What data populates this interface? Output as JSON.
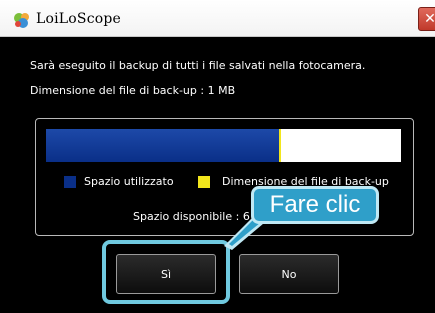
{
  "window": {
    "title": "LoiLoScope",
    "close_glyph": "✕",
    "icon": "loiloscope-app-icon"
  },
  "dialog": {
    "message_line1": "Sarà eseguito il backup di tutti i file salvati nella fotocamera.",
    "message_line2": "Dimensione del file di back-up : 1 MB"
  },
  "storage": {
    "used_fraction": 0.655,
    "backup_fraction": 0.005,
    "colors": {
      "used": "#0a2f88",
      "backup": "#f2e61c",
      "free": "#ffffff"
    },
    "legend": [
      {
        "label": "Spazio utilizzato",
        "color": "#0a2f88"
      },
      {
        "label": "Dimensione del file di back-up",
        "color": "#f2e61c"
      }
    ],
    "available_label": "Spazio disponibile : 6"
  },
  "buttons": {
    "yes_label": "Sì",
    "no_label": "No"
  },
  "annotation": {
    "callout_text": "Fare clic",
    "highlight_color": "#6fc9df"
  }
}
